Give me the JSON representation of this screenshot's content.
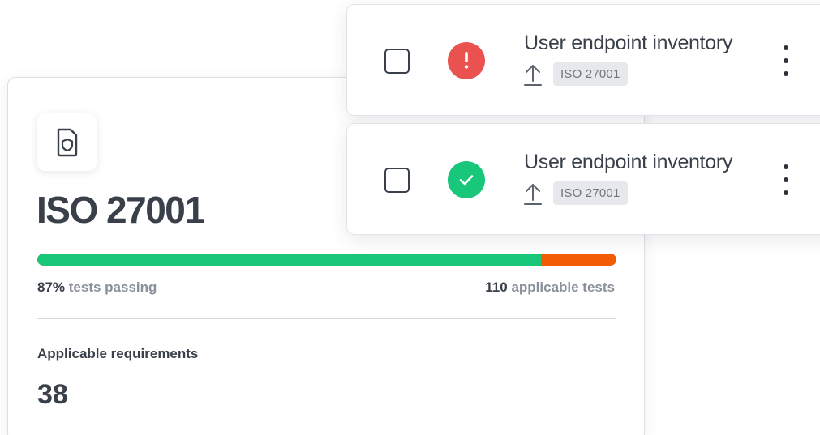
{
  "framework": {
    "title": "ISO 27001",
    "icon": "shield-document-icon",
    "progress_passing_percent": 87,
    "pass_value": "87%",
    "pass_label": " tests passing",
    "tests_value": "110",
    "tests_label": " applicable tests",
    "requirements_label": "Applicable requirements",
    "requirements_value": "38",
    "colors": {
      "pass": "#18c77a",
      "fail": "#f25c05"
    }
  },
  "tests": [
    {
      "title": "User endpoint inventory",
      "status": "fail",
      "status_icon": "exclamation-icon",
      "status_color": "#e9524f",
      "source_icon": "upload-arrow-icon",
      "tag": "ISO 27001"
    },
    {
      "title": "User endpoint inventory",
      "status": "pass",
      "status_icon": "checkmark-icon",
      "status_color": "#18c77a",
      "source_icon": "upload-arrow-icon",
      "tag": "ISO 27001"
    }
  ]
}
